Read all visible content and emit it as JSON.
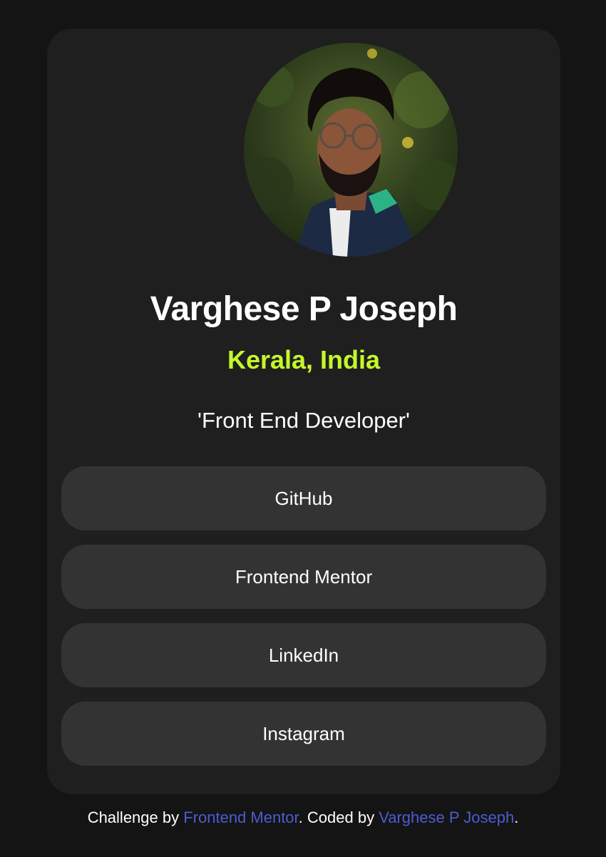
{
  "profile": {
    "name": "Varghese P Joseph",
    "location": "Kerala, India",
    "tagline": "'Front End Developer'"
  },
  "links": [
    {
      "label": "GitHub"
    },
    {
      "label": "Frontend Mentor"
    },
    {
      "label": "LinkedIn"
    },
    {
      "label": "Instagram"
    }
  ],
  "footer": {
    "prefix": "Challenge by ",
    "challenge_link": "Frontend Mentor",
    "middle": ". Coded by ",
    "author_link": "Varghese P Joseph",
    "suffix": "."
  },
  "colors": {
    "page_bg": "#141414",
    "card_bg": "#1f1f1f",
    "button_bg": "#333333",
    "accent_green": "#c4f82a",
    "link_blue": "#4d5cd1",
    "text": "#ffffff"
  }
}
